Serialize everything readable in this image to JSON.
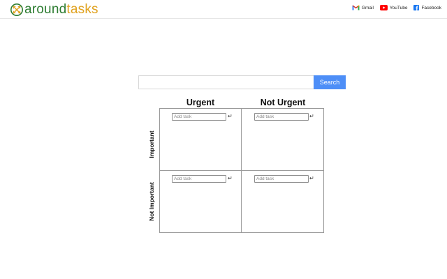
{
  "brand": {
    "name_part1": "around",
    "name_part2": "tasks",
    "color_part1": "#2e7d32",
    "color_part2": "#e0a21f",
    "logo_icon": "crossed-arrows-circle-icon"
  },
  "header_links": [
    {
      "label": "Gmail",
      "icon": "gmail-icon"
    },
    {
      "label": "YouTube",
      "icon": "youtube-icon"
    },
    {
      "label": "Facebook",
      "icon": "facebook-icon"
    }
  ],
  "search": {
    "value": "",
    "placeholder": "",
    "button_label": "Search",
    "button_color": "#4d8ef7"
  },
  "matrix": {
    "columns": [
      "Urgent",
      "Not Urgent"
    ],
    "rows": [
      "Important",
      "Not Important"
    ],
    "cells": [
      {
        "placeholder": "Add task",
        "value": ""
      },
      {
        "placeholder": "Add task",
        "value": ""
      },
      {
        "placeholder": "Add task",
        "value": ""
      },
      {
        "placeholder": "Add task",
        "value": ""
      }
    ],
    "enter_icon": "↵"
  }
}
